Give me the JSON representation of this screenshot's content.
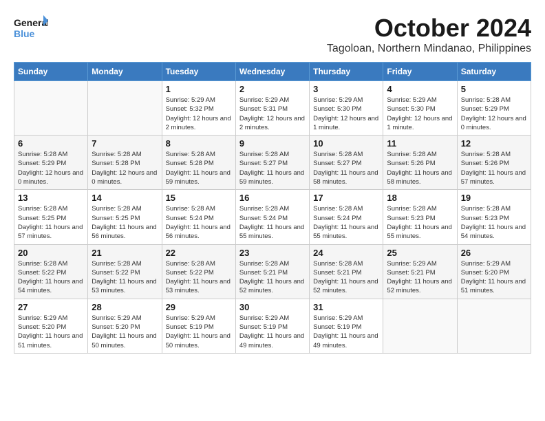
{
  "header": {
    "logo_line1": "General",
    "logo_line2": "Blue",
    "month": "October 2024",
    "location": "Tagoloan, Northern Mindanao, Philippines"
  },
  "weekdays": [
    "Sunday",
    "Monday",
    "Tuesday",
    "Wednesday",
    "Thursday",
    "Friday",
    "Saturday"
  ],
  "weeks": [
    [
      {
        "day": "",
        "info": ""
      },
      {
        "day": "",
        "info": ""
      },
      {
        "day": "1",
        "info": "Sunrise: 5:29 AM\nSunset: 5:32 PM\nDaylight: 12 hours and 2 minutes."
      },
      {
        "day": "2",
        "info": "Sunrise: 5:29 AM\nSunset: 5:31 PM\nDaylight: 12 hours and 2 minutes."
      },
      {
        "day": "3",
        "info": "Sunrise: 5:29 AM\nSunset: 5:30 PM\nDaylight: 12 hours and 1 minute."
      },
      {
        "day": "4",
        "info": "Sunrise: 5:29 AM\nSunset: 5:30 PM\nDaylight: 12 hours and 1 minute."
      },
      {
        "day": "5",
        "info": "Sunrise: 5:28 AM\nSunset: 5:29 PM\nDaylight: 12 hours and 0 minutes."
      }
    ],
    [
      {
        "day": "6",
        "info": "Sunrise: 5:28 AM\nSunset: 5:29 PM\nDaylight: 12 hours and 0 minutes."
      },
      {
        "day": "7",
        "info": "Sunrise: 5:28 AM\nSunset: 5:28 PM\nDaylight: 12 hours and 0 minutes."
      },
      {
        "day": "8",
        "info": "Sunrise: 5:28 AM\nSunset: 5:28 PM\nDaylight: 11 hours and 59 minutes."
      },
      {
        "day": "9",
        "info": "Sunrise: 5:28 AM\nSunset: 5:27 PM\nDaylight: 11 hours and 59 minutes."
      },
      {
        "day": "10",
        "info": "Sunrise: 5:28 AM\nSunset: 5:27 PM\nDaylight: 11 hours and 58 minutes."
      },
      {
        "day": "11",
        "info": "Sunrise: 5:28 AM\nSunset: 5:26 PM\nDaylight: 11 hours and 58 minutes."
      },
      {
        "day": "12",
        "info": "Sunrise: 5:28 AM\nSunset: 5:26 PM\nDaylight: 11 hours and 57 minutes."
      }
    ],
    [
      {
        "day": "13",
        "info": "Sunrise: 5:28 AM\nSunset: 5:25 PM\nDaylight: 11 hours and 57 minutes."
      },
      {
        "day": "14",
        "info": "Sunrise: 5:28 AM\nSunset: 5:25 PM\nDaylight: 11 hours and 56 minutes."
      },
      {
        "day": "15",
        "info": "Sunrise: 5:28 AM\nSunset: 5:24 PM\nDaylight: 11 hours and 56 minutes."
      },
      {
        "day": "16",
        "info": "Sunrise: 5:28 AM\nSunset: 5:24 PM\nDaylight: 11 hours and 55 minutes."
      },
      {
        "day": "17",
        "info": "Sunrise: 5:28 AM\nSunset: 5:24 PM\nDaylight: 11 hours and 55 minutes."
      },
      {
        "day": "18",
        "info": "Sunrise: 5:28 AM\nSunset: 5:23 PM\nDaylight: 11 hours and 55 minutes."
      },
      {
        "day": "19",
        "info": "Sunrise: 5:28 AM\nSunset: 5:23 PM\nDaylight: 11 hours and 54 minutes."
      }
    ],
    [
      {
        "day": "20",
        "info": "Sunrise: 5:28 AM\nSunset: 5:22 PM\nDaylight: 11 hours and 54 minutes."
      },
      {
        "day": "21",
        "info": "Sunrise: 5:28 AM\nSunset: 5:22 PM\nDaylight: 11 hours and 53 minutes."
      },
      {
        "day": "22",
        "info": "Sunrise: 5:28 AM\nSunset: 5:22 PM\nDaylight: 11 hours and 53 minutes."
      },
      {
        "day": "23",
        "info": "Sunrise: 5:28 AM\nSunset: 5:21 PM\nDaylight: 11 hours and 52 minutes."
      },
      {
        "day": "24",
        "info": "Sunrise: 5:28 AM\nSunset: 5:21 PM\nDaylight: 11 hours and 52 minutes."
      },
      {
        "day": "25",
        "info": "Sunrise: 5:29 AM\nSunset: 5:21 PM\nDaylight: 11 hours and 52 minutes."
      },
      {
        "day": "26",
        "info": "Sunrise: 5:29 AM\nSunset: 5:20 PM\nDaylight: 11 hours and 51 minutes."
      }
    ],
    [
      {
        "day": "27",
        "info": "Sunrise: 5:29 AM\nSunset: 5:20 PM\nDaylight: 11 hours and 51 minutes."
      },
      {
        "day": "28",
        "info": "Sunrise: 5:29 AM\nSunset: 5:20 PM\nDaylight: 11 hours and 50 minutes."
      },
      {
        "day": "29",
        "info": "Sunrise: 5:29 AM\nSunset: 5:19 PM\nDaylight: 11 hours and 50 minutes."
      },
      {
        "day": "30",
        "info": "Sunrise: 5:29 AM\nSunset: 5:19 PM\nDaylight: 11 hours and 49 minutes."
      },
      {
        "day": "31",
        "info": "Sunrise: 5:29 AM\nSunset: 5:19 PM\nDaylight: 11 hours and 49 minutes."
      },
      {
        "day": "",
        "info": ""
      },
      {
        "day": "",
        "info": ""
      }
    ]
  ]
}
